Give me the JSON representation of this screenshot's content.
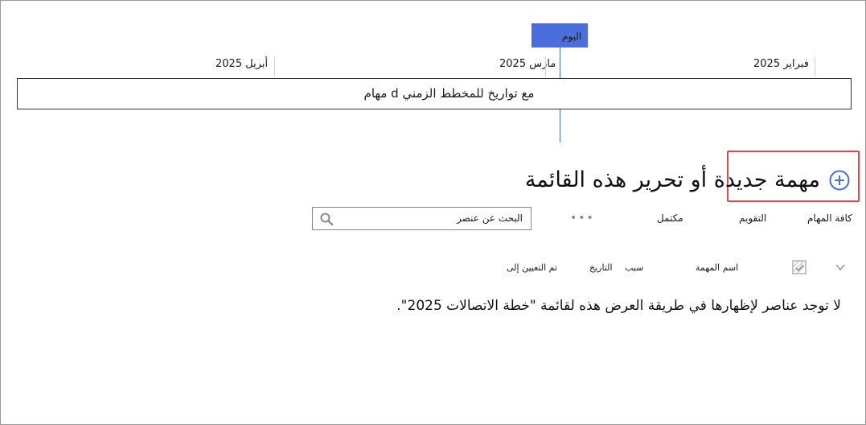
{
  "timeline": {
    "today_label": "اليوم",
    "months": [
      "أبريل 2025",
      "مارس 2025",
      "فبراير 2025"
    ],
    "bar_text": "مهام d مع تواريخ للمخطط الزمني"
  },
  "header": {
    "new_task_label": "مهمة جديدة أو تحرير هذه القائمة"
  },
  "views": {
    "all_tasks": "كافة المهام",
    "calendar": "التقويم",
    "completed": "مكتمل",
    "more": "•••"
  },
  "search": {
    "placeholder": "البحث عن عنصر"
  },
  "columns": {
    "task_name": "اسم المهمة",
    "reason": "سبب",
    "date": "التاريخ",
    "assigned_to": "تم التعيين إلى"
  },
  "list": {
    "empty_message": "لا توجد عناصر لإظهارها في طريقة العرض هذه لقائمة \"خطة الاتصالات 2025\"."
  },
  "colors": {
    "accent": "#4a6fdc",
    "highlight_border": "#e0464e"
  },
  "icons": {
    "add": "plus-circle-icon",
    "search": "magnifier-icon",
    "expand": "chevron-down-icon",
    "select_all": "select-all-icon"
  }
}
